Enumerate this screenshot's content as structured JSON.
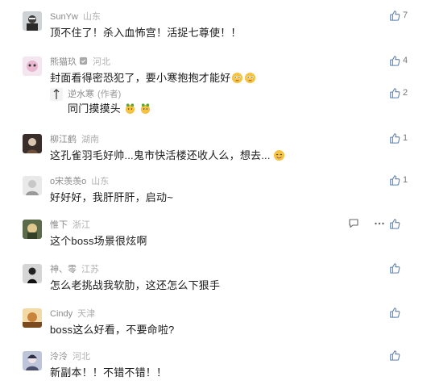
{
  "comments": [
    {
      "name": "SunYw",
      "location": "山东",
      "text": "顶不住了！杀入血怖宫！活捉七尊使！！",
      "likes": "7"
    },
    {
      "name": "熊猫玖",
      "location": "河北",
      "text": "封面看得密恐犯了，要小寒抱抱才能好",
      "likes": "4",
      "reply": {
        "name": "逆水寒",
        "tag": "(作者)",
        "text": "同门摸摸头",
        "likes": "2"
      }
    },
    {
      "name": "柳江鹤",
      "location": "湖南",
      "text": "这孔雀羽毛好帅...鬼市快活楼还收人么，想去...",
      "likes": "1"
    },
    {
      "name": "o宋羡羡o",
      "location": "山东",
      "text": "好好好，我肝肝肝，启动~",
      "likes": "1"
    },
    {
      "name": "惟下",
      "location": "浙江",
      "text": "这个boss场景很炫啊",
      "likes": ""
    },
    {
      "name": "神、零",
      "location": "江苏",
      "text": "怎么老挑战我软肋，这还怎么下狠手",
      "likes": ""
    },
    {
      "name": "Cindy",
      "location": "天津",
      "text": "boss这么好看，不要命啦?",
      "likes": ""
    },
    {
      "name": "泠泠",
      "location": "河北",
      "text": "新副本！！不错不错！！",
      "likes": ""
    }
  ],
  "colors": {
    "meta": "#8a8a8a",
    "text": "#1a1a1a",
    "emoji": "#f5c242"
  },
  "icons": {
    "like": "thumbs-up-icon",
    "comment": "comment-icon",
    "more": "more-icon",
    "emoji": "emoji-icon"
  }
}
